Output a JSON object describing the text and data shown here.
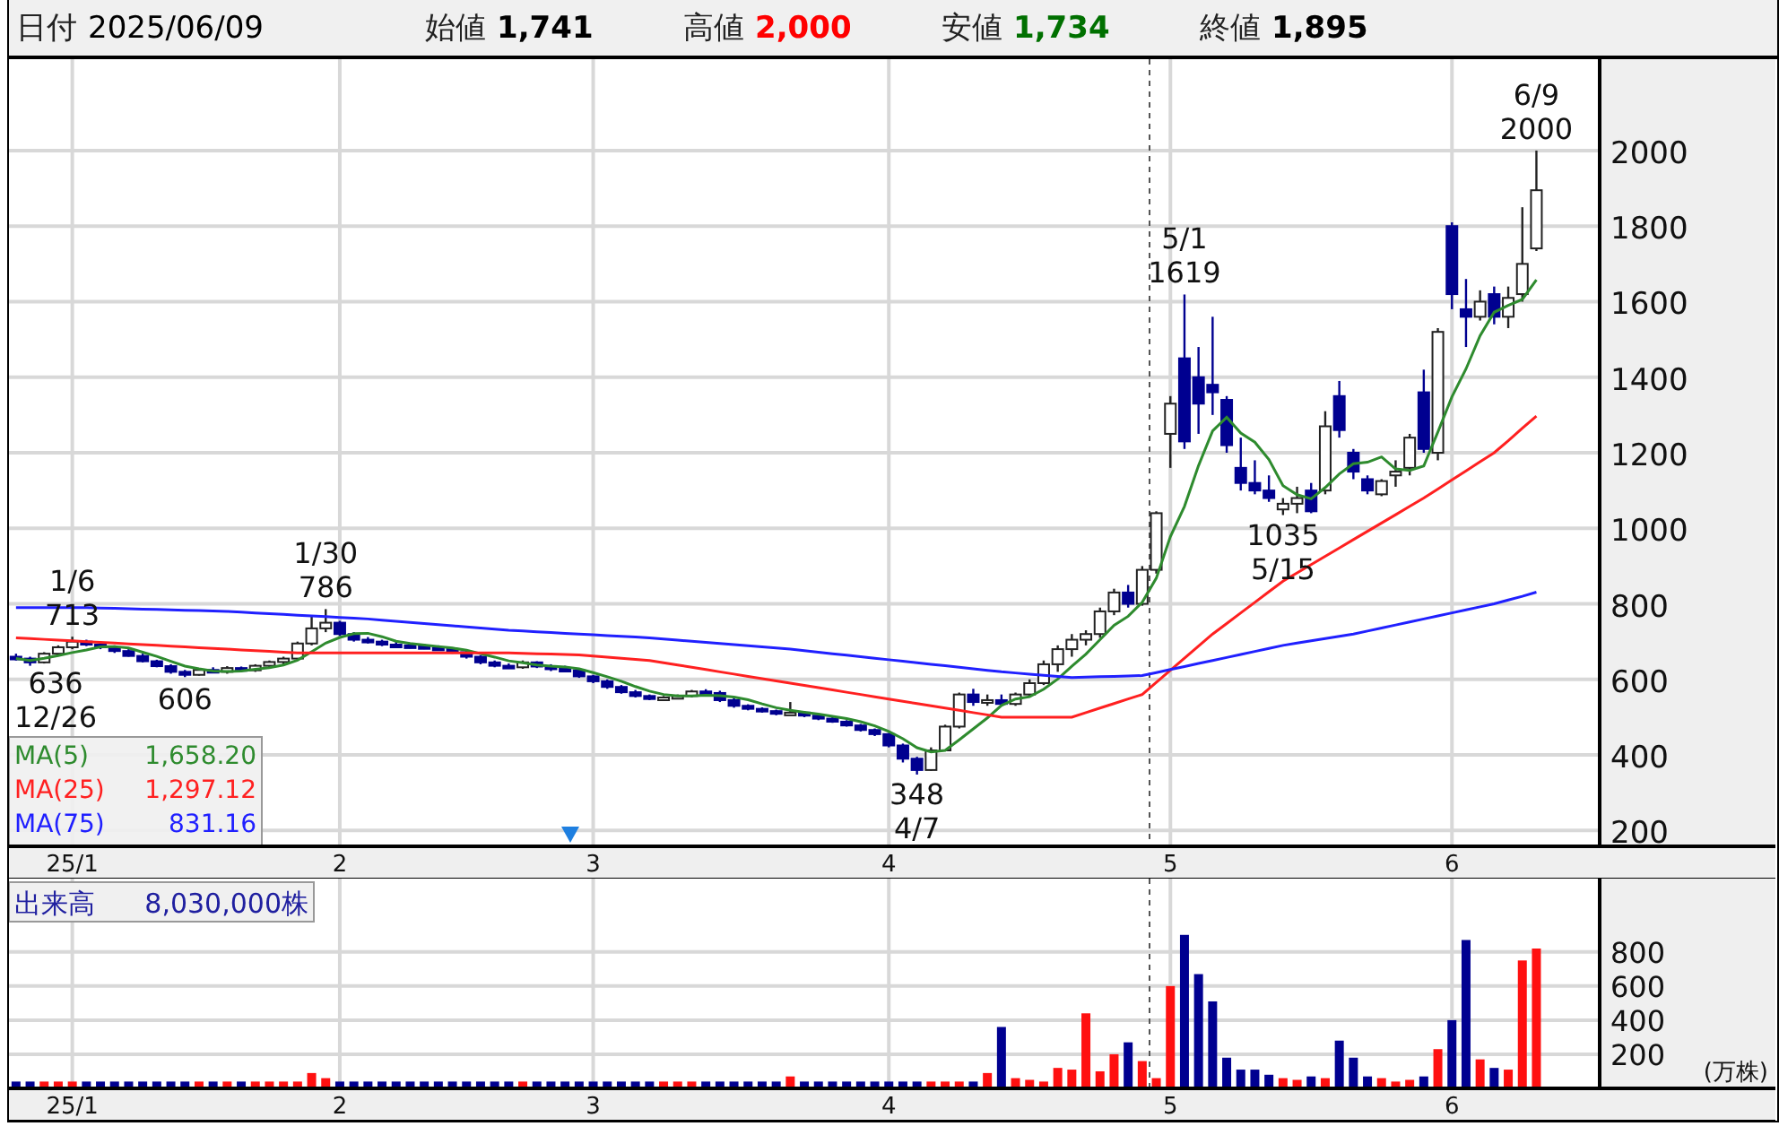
{
  "header": {
    "date_label": "日付",
    "date": "2025/06/09",
    "quotes": [
      {
        "label": "始値",
        "value": "1,741",
        "color": "#000000"
      },
      {
        "label": "高値",
        "value": "2,000",
        "color": "#ff0000"
      },
      {
        "label": "安値",
        "value": "1,734",
        "color": "#007000"
      },
      {
        "label": "終値",
        "value": "1,895",
        "color": "#000000"
      }
    ]
  },
  "price_chart": {
    "chart_data": {
      "type": "candlestick",
      "grid": true,
      "ylim": [
        158,
        2242
      ],
      "yticks": [
        200,
        400,
        600,
        800,
        1000,
        1200,
        1400,
        1600,
        1800,
        2000
      ],
      "categories": [
        null,
        null,
        null,
        null,
        "25/1",
        null,
        null,
        null,
        null,
        null,
        null,
        null,
        null,
        null,
        null,
        null,
        null,
        null,
        null,
        null,
        null,
        null,
        null,
        "2",
        null,
        null,
        null,
        null,
        null,
        null,
        null,
        null,
        null,
        null,
        null,
        null,
        null,
        null,
        null,
        null,
        null,
        "3",
        null,
        null,
        null,
        null,
        null,
        null,
        null,
        null,
        null,
        null,
        null,
        null,
        null,
        null,
        null,
        null,
        null,
        null,
        null,
        null,
        "4",
        null,
        null,
        null,
        null,
        null,
        null,
        null,
        null,
        null,
        null,
        null,
        null,
        null,
        null,
        null,
        null,
        null,
        null,
        null,
        "5",
        null,
        null,
        null,
        null,
        null,
        null,
        null,
        null,
        null,
        null,
        null,
        null,
        null,
        null,
        null,
        null,
        null,
        null,
        null,
        "6",
        null,
        null,
        null,
        null,
        null,
        null
      ],
      "ohlc": [
        [
          660,
          668,
          650,
          655
        ],
        [
          655,
          660,
          636,
          645
        ],
        [
          645,
          672,
          642,
          668
        ],
        [
          668,
          690,
          662,
          685
        ],
        [
          685,
          713,
          680,
          700
        ],
        [
          700,
          705,
          688,
          692
        ],
        [
          692,
          698,
          680,
          685
        ],
        [
          685,
          690,
          670,
          675
        ],
        [
          675,
          680,
          660,
          662
        ],
        [
          662,
          668,
          645,
          648
        ],
        [
          648,
          652,
          632,
          635
        ],
        [
          635,
          640,
          615,
          620
        ],
        [
          620,
          625,
          606,
          612
        ],
        [
          612,
          628,
          610,
          625
        ],
        [
          625,
          632,
          618,
          620
        ],
        [
          620,
          635,
          615,
          630
        ],
        [
          630,
          634,
          620,
          624
        ],
        [
          624,
          640,
          620,
          636
        ],
        [
          636,
          650,
          630,
          646
        ],
        [
          646,
          660,
          640,
          655
        ],
        [
          655,
          700,
          650,
          695
        ],
        [
          695,
          770,
          690,
          735
        ],
        [
          735,
          786,
          725,
          750
        ],
        [
          750,
          755,
          715,
          720
        ],
        [
          720,
          725,
          700,
          705
        ],
        [
          705,
          712,
          695,
          700
        ],
        [
          700,
          705,
          688,
          692
        ],
        [
          692,
          700,
          685,
          690
        ],
        [
          690,
          696,
          682,
          688
        ],
        [
          688,
          694,
          680,
          684
        ],
        [
          684,
          690,
          676,
          680
        ],
        [
          680,
          684,
          668,
          672
        ],
        [
          672,
          676,
          655,
          660
        ],
        [
          660,
          664,
          640,
          645
        ],
        [
          645,
          650,
          632,
          636
        ],
        [
          636,
          642,
          628,
          632
        ],
        [
          632,
          650,
          628,
          645
        ],
        [
          645,
          648,
          630,
          634
        ],
        [
          634,
          640,
          622,
          628
        ],
        [
          628,
          636,
          620,
          624
        ],
        [
          624,
          630,
          604,
          608
        ],
        [
          608,
          612,
          590,
          595
        ],
        [
          595,
          600,
          575,
          580
        ],
        [
          580,
          585,
          562,
          566
        ],
        [
          566,
          572,
          552,
          556
        ],
        [
          556,
          560,
          545,
          548
        ],
        [
          548,
          556,
          544,
          552
        ],
        [
          552,
          560,
          548,
          556
        ],
        [
          556,
          572,
          552,
          568
        ],
        [
          568,
          574,
          560,
          564
        ],
        [
          564,
          570,
          540,
          545
        ],
        [
          545,
          552,
          525,
          530
        ],
        [
          530,
          534,
          518,
          522
        ],
        [
          522,
          526,
          512,
          516
        ],
        [
          516,
          520,
          505,
          510
        ],
        [
          510,
          540,
          506,
          512
        ],
        [
          512,
          516,
          500,
          504
        ],
        [
          504,
          508,
          492,
          496
        ],
        [
          496,
          500,
          485,
          488
        ],
        [
          488,
          492,
          475,
          478
        ],
        [
          478,
          482,
          462,
          466
        ],
        [
          466,
          470,
          450,
          455
        ],
        [
          455,
          458,
          420,
          425
        ],
        [
          425,
          430,
          380,
          390
        ],
        [
          390,
          395,
          348,
          360
        ],
        [
          360,
          420,
          358,
          412
        ],
        [
          412,
          480,
          410,
          475
        ],
        [
          475,
          565,
          470,
          560
        ],
        [
          560,
          575,
          530,
          540
        ],
        [
          540,
          560,
          530,
          545
        ],
        [
          545,
          560,
          530,
          535
        ],
        [
          535,
          565,
          530,
          560
        ],
        [
          560,
          600,
          552,
          590
        ],
        [
          590,
          650,
          585,
          640
        ],
        [
          640,
          690,
          620,
          680
        ],
        [
          680,
          720,
          660,
          705
        ],
        [
          705,
          730,
          690,
          720
        ],
        [
          720,
          790,
          710,
          780
        ],
        [
          780,
          840,
          770,
          830
        ],
        [
          830,
          850,
          790,
          800
        ],
        [
          800,
          900,
          795,
          890
        ],
        [
          890,
          1045,
          880,
          1040
        ],
        [
          1250,
          1350,
          1160,
          1330
        ],
        [
          1450,
          1619,
          1210,
          1230
        ],
        [
          1400,
          1480,
          1250,
          1330
        ],
        [
          1380,
          1560,
          1300,
          1360
        ],
        [
          1340,
          1350,
          1200,
          1220
        ],
        [
          1160,
          1240,
          1100,
          1120
        ],
        [
          1120,
          1180,
          1090,
          1100
        ],
        [
          1100,
          1140,
          1070,
          1080
        ],
        [
          1050,
          1080,
          1035,
          1065
        ],
        [
          1065,
          1110,
          1040,
          1080
        ],
        [
          1100,
          1120,
          1040,
          1045
        ],
        [
          1100,
          1310,
          1090,
          1270
        ],
        [
          1350,
          1390,
          1240,
          1260
        ],
        [
          1200,
          1210,
          1130,
          1150
        ],
        [
          1130,
          1140,
          1090,
          1100
        ],
        [
          1090,
          1130,
          1085,
          1125
        ],
        [
          1140,
          1180,
          1110,
          1150
        ],
        [
          1160,
          1250,
          1140,
          1240
        ],
        [
          1360,
          1420,
          1200,
          1210
        ],
        [
          1200,
          1530,
          1180,
          1520
        ],
        [
          1800,
          1810,
          1580,
          1620
        ],
        [
          1580,
          1660,
          1480,
          1560
        ],
        [
          1560,
          1630,
          1550,
          1600
        ],
        [
          1620,
          1640,
          1540,
          1560
        ],
        [
          1560,
          1640,
          1530,
          1610
        ],
        [
          1620,
          1850,
          1600,
          1700
        ],
        [
          1741,
          2000,
          1734,
          1895
        ]
      ],
      "series": [
        {
          "name": "MA(5)",
          "type": "line",
          "color": "#2e8b2e",
          "values": [
            655,
            650,
            656,
            663,
            671,
            678,
            686,
            687,
            683,
            672,
            661,
            648,
            635,
            628,
            622,
            621,
            622,
            627,
            631,
            638,
            651,
            673,
            696,
            711,
            721,
            722,
            713,
            701,
            695,
            691,
            687,
            683,
            677,
            668,
            659,
            649,
            644,
            638,
            635,
            633,
            628,
            618,
            607,
            595,
            581,
            569,
            560,
            556,
            556,
            558,
            557,
            553,
            546,
            535,
            525,
            518,
            513,
            508,
            502,
            496,
            488,
            477,
            462,
            443,
            419,
            408,
            412,
            440,
            469,
            498,
            531,
            548,
            554,
            574,
            601,
            635,
            667,
            705,
            743,
            767,
            804,
            868,
            978,
            1058,
            1166,
            1258,
            1294,
            1252,
            1228,
            1182,
            1113,
            1089,
            1078,
            1108,
            1144,
            1171,
            1175,
            1189,
            1157,
            1153,
            1165,
            1255,
            1348,
            1422,
            1510,
            1572,
            1590,
            1606,
            1658
          ]
        },
        {
          "name": "MA(25)",
          "type": "line",
          "color": "#ff2020",
          "values": [
            710,
            708,
            706,
            704,
            702,
            700,
            698,
            696,
            694,
            692,
            690,
            688,
            686,
            684,
            682,
            680,
            678,
            676,
            674,
            672,
            670,
            670,
            670,
            670,
            670,
            670,
            670,
            670,
            670,
            670,
            670,
            670,
            670,
            670,
            670,
            670,
            669,
            668,
            667,
            666,
            665,
            662,
            659,
            656,
            653,
            650,
            644,
            638,
            632,
            626,
            620,
            614,
            608,
            602,
            596,
            590,
            584,
            578,
            572,
            566,
            560,
            554,
            548,
            542,
            536,
            530,
            524,
            518,
            512,
            506,
            500,
            500,
            500,
            500,
            500,
            500,
            512,
            524,
            536,
            548,
            560,
            592,
            624,
            656,
            688,
            720,
            748,
            776,
            804,
            832,
            860,
            882,
            904,
            926,
            948,
            970,
            992,
            1014,
            1036,
            1058,
            1080,
            1104,
            1128,
            1152,
            1176,
            1200,
            1232,
            1265,
            1297
          ]
        },
        {
          "name": "MA(75)",
          "type": "line",
          "color": "#2020ff",
          "values": [
            790,
            790,
            790,
            790,
            790,
            790,
            789,
            788,
            787,
            786,
            785,
            784,
            783,
            782,
            781,
            780,
            778,
            776,
            774,
            772,
            770,
            768,
            766,
            764,
            762,
            760,
            757,
            754,
            751,
            748,
            745,
            742,
            739,
            736,
            733,
            730,
            728,
            726,
            724,
            722,
            720,
            718,
            716,
            714,
            712,
            710,
            707,
            704,
            701,
            698,
            695,
            692,
            689,
            686,
            683,
            680,
            676,
            672,
            668,
            664,
            660,
            656,
            652,
            648,
            644,
            640,
            636,
            632,
            628,
            624,
            620,
            617,
            614,
            611,
            608,
            605,
            606,
            607,
            608,
            609,
            610,
            618,
            626,
            634,
            642,
            650,
            658,
            666,
            674,
            682,
            690,
            696,
            702,
            708,
            714,
            720,
            728,
            736,
            744,
            752,
            760,
            768,
            776,
            784,
            792,
            800,
            810,
            820,
            831
          ]
        }
      ]
    },
    "peak_labels": [
      {
        "text": [
          "1/6",
          "713"
        ]
      },
      {
        "text": [
          "636",
          "12/26"
        ]
      },
      {
        "text": [
          "1/30",
          "786"
        ]
      },
      {
        "text": [
          "606"
        ]
      },
      {
        "text": [
          "348",
          "4/7"
        ]
      },
      {
        "text": [
          "5/1",
          "1619"
        ]
      },
      {
        "text": [
          "1035",
          "5/15"
        ]
      },
      {
        "text": [
          "6/9",
          "2000"
        ]
      }
    ],
    "legend": [
      {
        "value": "1,658.20"
      },
      {
        "value": "1,297.12"
      },
      {
        "value": "831.16"
      }
    ]
  },
  "volume_chart": {
    "title": "出来高",
    "total": "8,030,000株",
    "unit": "(万株)",
    "chart_data": {
      "type": "bar",
      "grid": true,
      "ylim": [
        0,
        1230
      ],
      "yticks": [
        200,
        400,
        600,
        800
      ],
      "categories": [
        null,
        null,
        null,
        null,
        "25/1",
        null,
        null,
        null,
        null,
        null,
        null,
        null,
        null,
        null,
        null,
        null,
        null,
        null,
        null,
        null,
        null,
        null,
        null,
        "2",
        null,
        null,
        null,
        null,
        null,
        null,
        null,
        null,
        null,
        null,
        null,
        null,
        null,
        null,
        null,
        null,
        null,
        "3",
        null,
        null,
        null,
        null,
        null,
        null,
        null,
        null,
        null,
        null,
        null,
        null,
        null,
        null,
        null,
        null,
        null,
        null,
        null,
        null,
        "4",
        null,
        null,
        null,
        null,
        null,
        null,
        null,
        null,
        null,
        null,
        null,
        null,
        null,
        null,
        null,
        null,
        null,
        null,
        null,
        "5",
        null,
        null,
        null,
        null,
        null,
        null,
        null,
        null,
        null,
        null,
        null,
        null,
        null,
        null,
        null,
        null,
        null,
        null,
        null,
        "6",
        null,
        null,
        null,
        null,
        null,
        null
      ],
      "series": [
        {
          "color": "#ff1010",
          "values": [
            null,
            null,
            40,
            40,
            40,
            null,
            null,
            null,
            null,
            null,
            null,
            null,
            null,
            40,
            null,
            40,
            null,
            40,
            40,
            40,
            40,
            90,
            60,
            null,
            null,
            null,
            null,
            null,
            null,
            null,
            null,
            null,
            null,
            null,
            null,
            null,
            40,
            null,
            null,
            null,
            null,
            null,
            null,
            null,
            null,
            null,
            40,
            40,
            40,
            null,
            null,
            null,
            null,
            null,
            null,
            70,
            null,
            null,
            null,
            null,
            null,
            null,
            null,
            null,
            null,
            40,
            40,
            40,
            null,
            90,
            null,
            60,
            50,
            40,
            120,
            110,
            440,
            100,
            200,
            null,
            160,
            60,
            600,
            null,
            null,
            null,
            null,
            null,
            null,
            null,
            60,
            50,
            null,
            60,
            null,
            null,
            null,
            60,
            40,
            50,
            null,
            230,
            null,
            null,
            170,
            null,
            110,
            750,
            820
          ]
        },
        {
          "color": "#000090",
          "values": [
            40,
            40,
            null,
            null,
            null,
            40,
            40,
            40,
            40,
            40,
            40,
            40,
            40,
            null,
            40,
            null,
            40,
            null,
            null,
            null,
            null,
            null,
            null,
            40,
            40,
            40,
            40,
            40,
            40,
            40,
            40,
            40,
            40,
            40,
            40,
            40,
            null,
            40,
            40,
            40,
            40,
            40,
            40,
            40,
            40,
            40,
            null,
            null,
            null,
            40,
            40,
            40,
            40,
            40,
            40,
            null,
            40,
            40,
            40,
            40,
            40,
            40,
            40,
            40,
            40,
            null,
            null,
            null,
            40,
            null,
            360,
            null,
            null,
            null,
            null,
            null,
            null,
            null,
            null,
            270,
            null,
            null,
            null,
            900,
            670,
            510,
            180,
            110,
            110,
            80,
            null,
            null,
            70,
            null,
            280,
            180,
            70,
            null,
            null,
            null,
            70,
            null,
            400,
            870,
            null,
            120,
            null,
            null,
            null
          ]
        }
      ]
    }
  }
}
